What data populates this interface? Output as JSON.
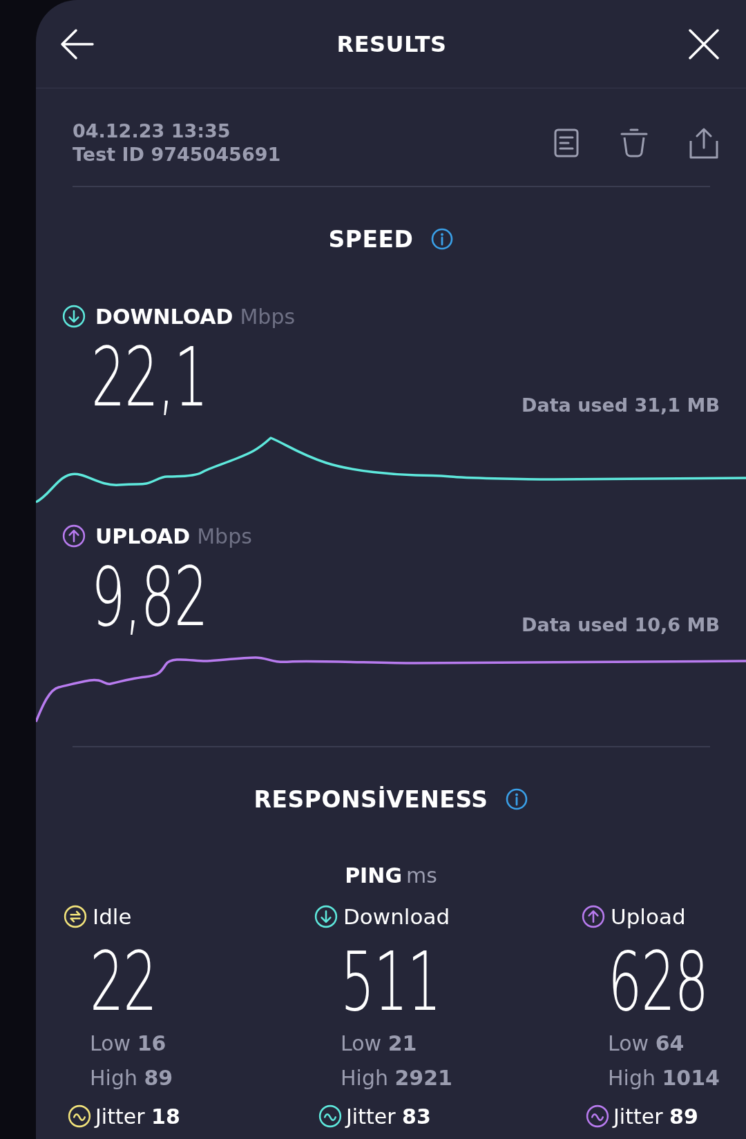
{
  "header": {
    "title": "RESULTS"
  },
  "test": {
    "date": "04.12.23 13:35",
    "test_id": "Test ID 9745045691"
  },
  "speed": {
    "title": "SPEED",
    "metrics": [
      {
        "kind": "download",
        "label": "DOWNLOAD",
        "unit": "Mbps",
        "value": "22,1",
        "data_used": "Data used 31,1 MB",
        "color": "#5ee8dc"
      },
      {
        "kind": "upload",
        "label": "UPLOAD",
        "unit": "Mbps",
        "value": "9,82",
        "data_used": "Data used 10,6 MB",
        "color": "#b87bef"
      }
    ]
  },
  "responsiveness": {
    "title": "RESPONSİVENESS",
    "ping_label": "PING",
    "ping_unit": "ms",
    "columns": [
      {
        "kind": "idle",
        "label": "Idle",
        "value": "22",
        "low": "Low **16**",
        "high": "High **89**",
        "jitter": "Jitter **18**",
        "color": "#f2e37b"
      },
      {
        "kind": "download",
        "label": "Download",
        "value": "511",
        "low": "Low **21**",
        "high": "High **2921**",
        "jitter": "Jitter **83**",
        "color": "#5ee8dc"
      },
      {
        "kind": "upload",
        "label": "Upload",
        "value": "628",
        "low": "Low **64**",
        "high": "High **1014**",
        "jitter": "Jitter **89**",
        "color": "#b87bef"
      }
    ]
  }
}
